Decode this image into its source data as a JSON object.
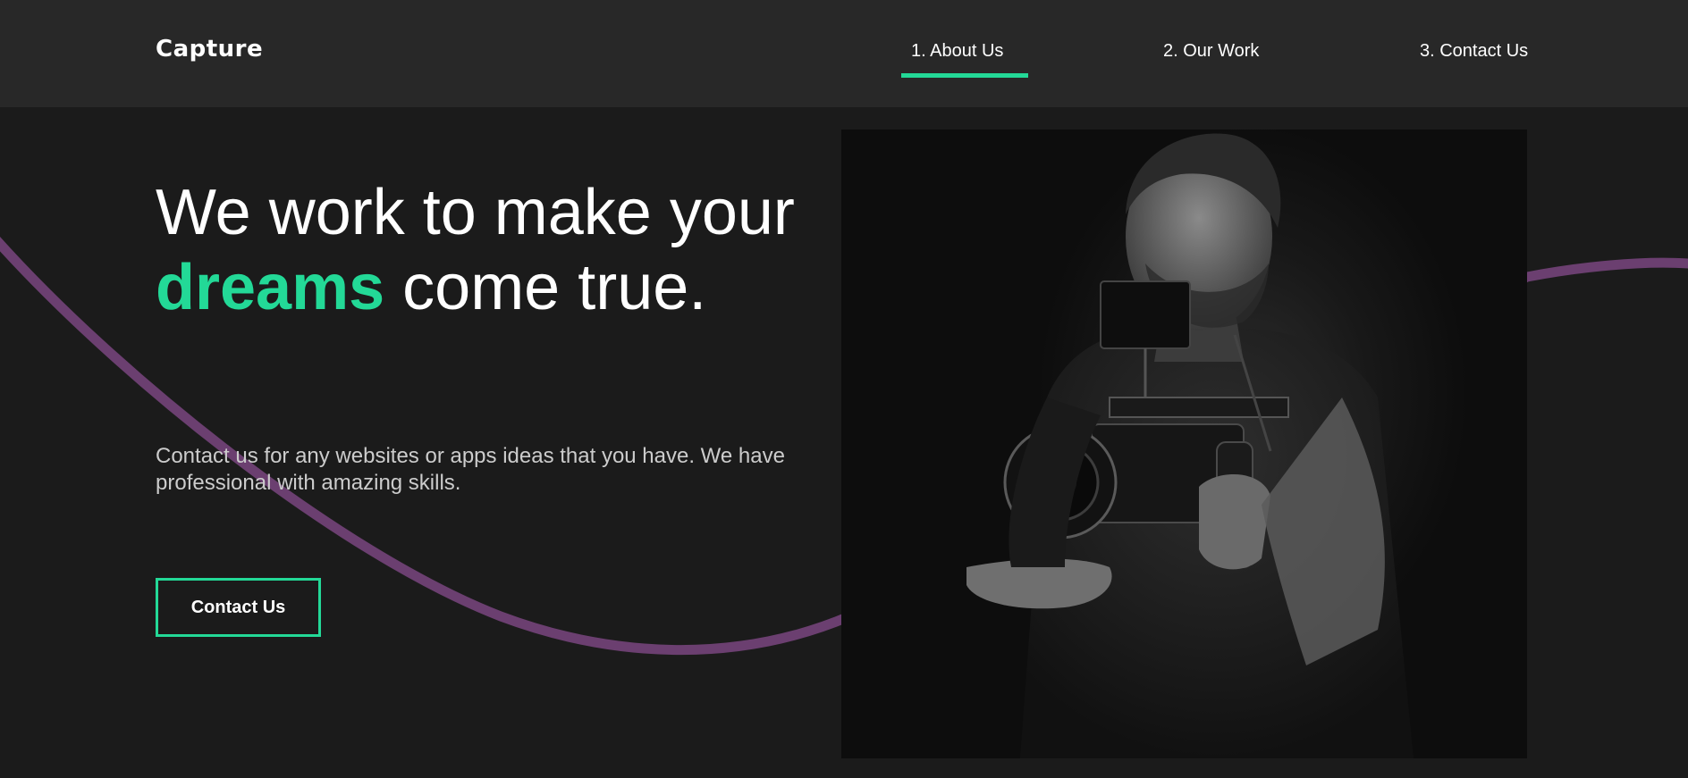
{
  "logo": {
    "text": "Capture"
  },
  "nav": {
    "items": [
      {
        "label": "1. About Us",
        "active": true
      },
      {
        "label": "2. Our Work",
        "active": false
      },
      {
        "label": "3. Contact Us",
        "active": false
      }
    ]
  },
  "hero": {
    "title_before": "We work to make your ",
    "title_highlight": "dreams",
    "title_after": " come true.",
    "description": "Contact us for any websites or apps ideas that you have. We have professional with amazing skills.",
    "cta_label": "Contact Us",
    "image_subject": "photographer-with-camera-rig"
  },
  "colors": {
    "accent": "#23d997",
    "wave": "#6b3f70",
    "background": "#1b1b1b",
    "navbar": "#282828"
  }
}
